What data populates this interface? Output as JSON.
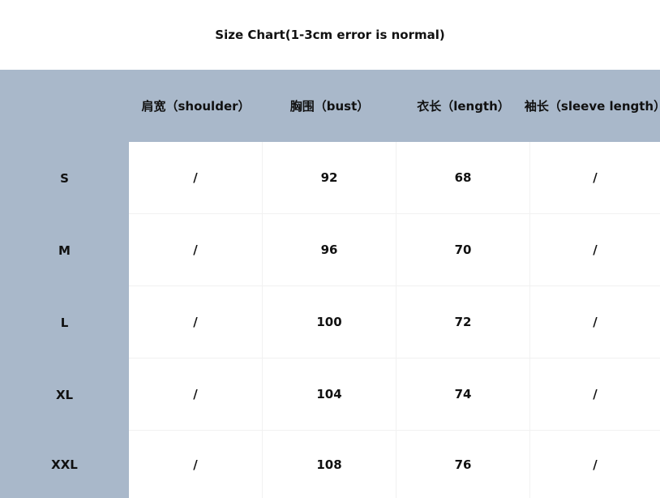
{
  "title": "Size Chart(1-3cm error is normal)",
  "headers": [
    "",
    "肩宽（shoulder）",
    "胸围（bust）",
    "衣长（length）",
    "袖长（sleeve length）"
  ],
  "rows": [
    {
      "size": "S",
      "shoulder": "/",
      "bust": "92",
      "length": "68",
      "sleeve": "/"
    },
    {
      "size": "M",
      "shoulder": "/",
      "bust": "96",
      "length": "70",
      "sleeve": "/"
    },
    {
      "size": "L",
      "shoulder": "/",
      "bust": "100",
      "length": "72",
      "sleeve": "/"
    },
    {
      "size": "XL",
      "shoulder": "/",
      "bust": "104",
      "length": "74",
      "sleeve": "/"
    },
    {
      "size": "XXL",
      "shoulder": "/",
      "bust": "108",
      "length": "76",
      "sleeve": "/"
    }
  ],
  "colors": {
    "header_bg": "#a9b8ca",
    "cell_bg": "#ffffff",
    "text": "#111111"
  }
}
